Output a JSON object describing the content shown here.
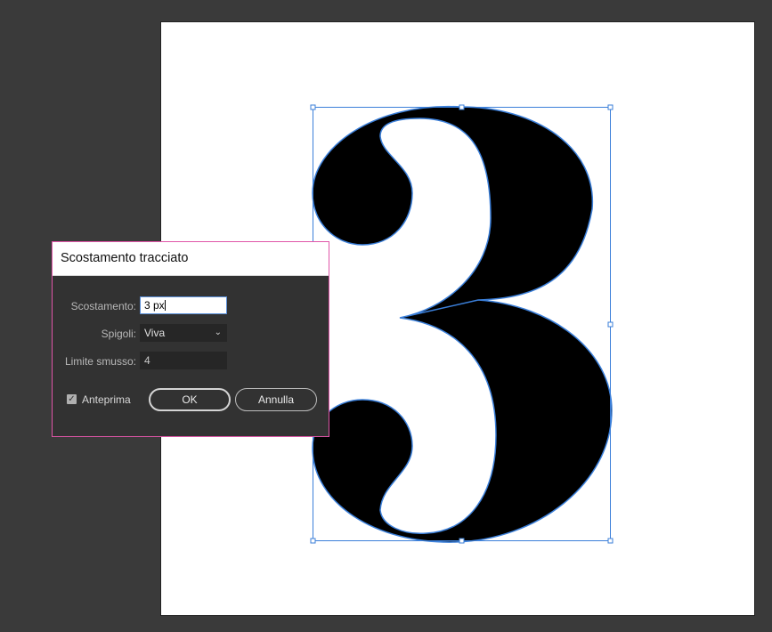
{
  "dialog": {
    "title": "Scostamento tracciato",
    "offset": {
      "label": "Scostamento:",
      "value": "3 px"
    },
    "corners": {
      "label": "Spigoli:",
      "value": "Viva"
    },
    "miter_limit": {
      "label": "Limite smusso:",
      "value": "4"
    },
    "preview": {
      "label": "Anteprima",
      "checked": true
    },
    "ok_label": "OK",
    "cancel_label": "Annulla"
  },
  "artboard": {
    "glyph": "3"
  },
  "colors": {
    "workspace": "#3a3a3a",
    "artboard": "#ffffff",
    "selection": "#3b7fd9",
    "dialog_border": "#e056a8",
    "dialog_bg": "#323232"
  }
}
